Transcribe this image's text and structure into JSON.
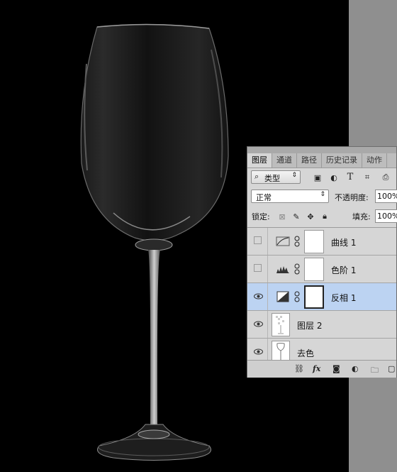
{
  "panel": {
    "tabs": [
      "图层",
      "通道",
      "路径",
      "历史记录",
      "动作"
    ],
    "filter": {
      "search_icon": "search-icon",
      "kind_label": "类型"
    },
    "blend_mode": "正常",
    "opacity_label": "不透明度:",
    "opacity_value": "100%",
    "lock_label": "锁定:",
    "fill_label": "填充:",
    "fill_value": "100%",
    "layers": [
      {
        "name": "曲线 1",
        "visible": false,
        "type": "curves"
      },
      {
        "name": "色阶 1",
        "visible": false,
        "type": "levels"
      },
      {
        "name": "反相 1",
        "visible": true,
        "type": "invert",
        "selected": true
      },
      {
        "name": "图层 2",
        "visible": true,
        "type": "pixel"
      },
      {
        "name": "去色",
        "visible": true,
        "type": "pixel"
      }
    ],
    "bottom_icons": [
      "link-icon",
      "fx-icon",
      "mask-icon",
      "adjustment-icon",
      "folder-icon",
      "new-layer-icon"
    ],
    "fx_label": "fx"
  },
  "colors": {
    "canvas": "#000000",
    "panel": "#d6d6d6",
    "selected_layer": "#bcd3f2",
    "side": "#8f8f8f"
  }
}
